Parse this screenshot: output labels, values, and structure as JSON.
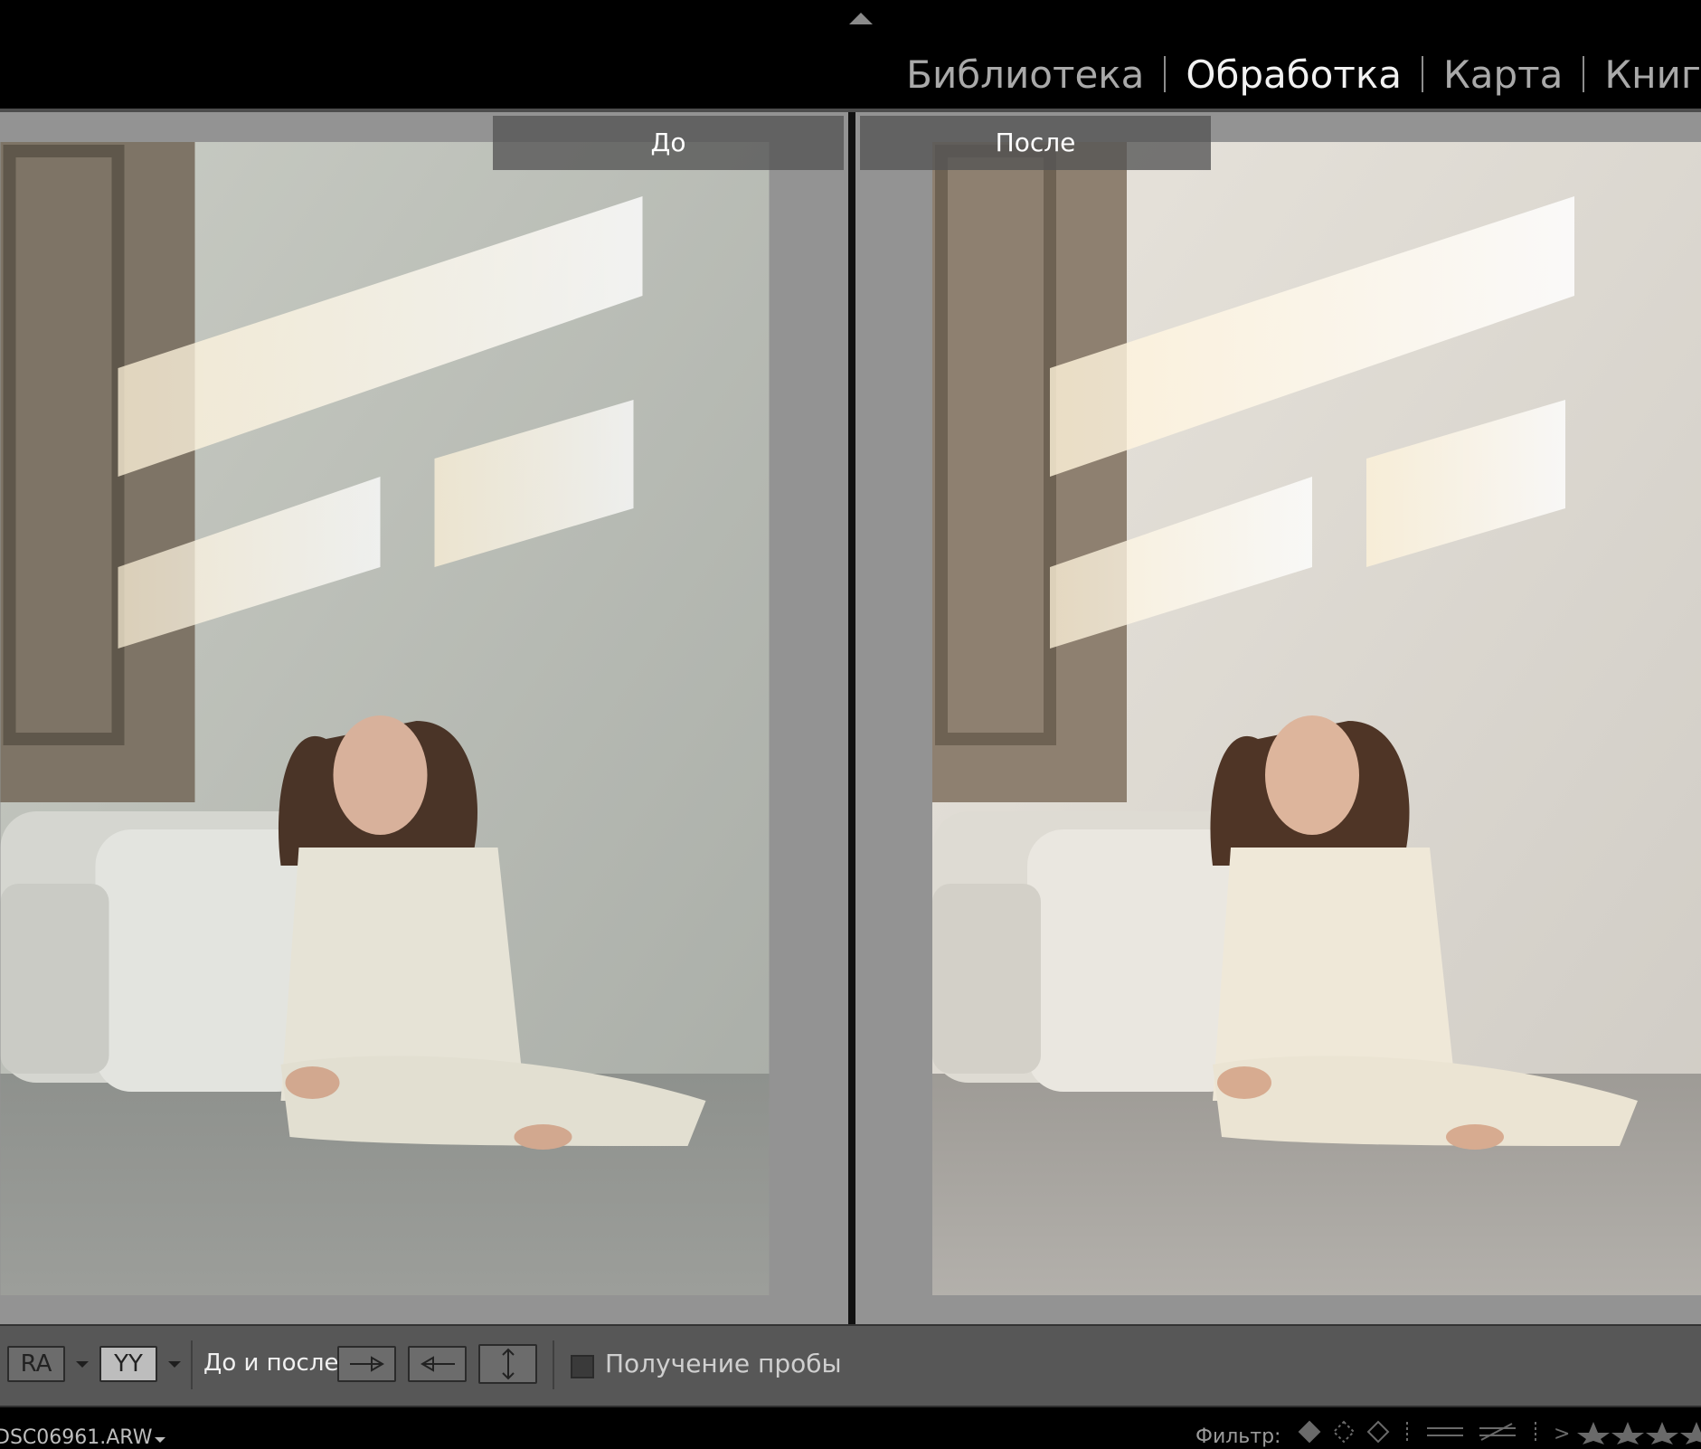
{
  "modules": {
    "library": "Библиотека",
    "develop": "Обработка",
    "map": "Карта",
    "book": "Книг"
  },
  "view": {
    "before_label": "До",
    "after_label": "После"
  },
  "toolbar": {
    "view_mode_1": "RA",
    "view_mode_2": "YY",
    "before_after_label": "До и после:",
    "sampler_label": "Получение пробы",
    "sampler_checked": false
  },
  "filmstrip": {
    "filename": "DSC06961.ARW",
    "filter_label": "Фильтр:"
  },
  "icons": [
    "collapse-top-icon",
    "copy-before-to-after-icon",
    "copy-after-to-before-icon",
    "swap-icon",
    "flag-icon",
    "star-icon"
  ],
  "colors": {
    "active_module": "#f2f2f2",
    "inactive_module": "#a9a9a9",
    "pane_bg": "#939393",
    "toolbar_bg": "#575757"
  }
}
